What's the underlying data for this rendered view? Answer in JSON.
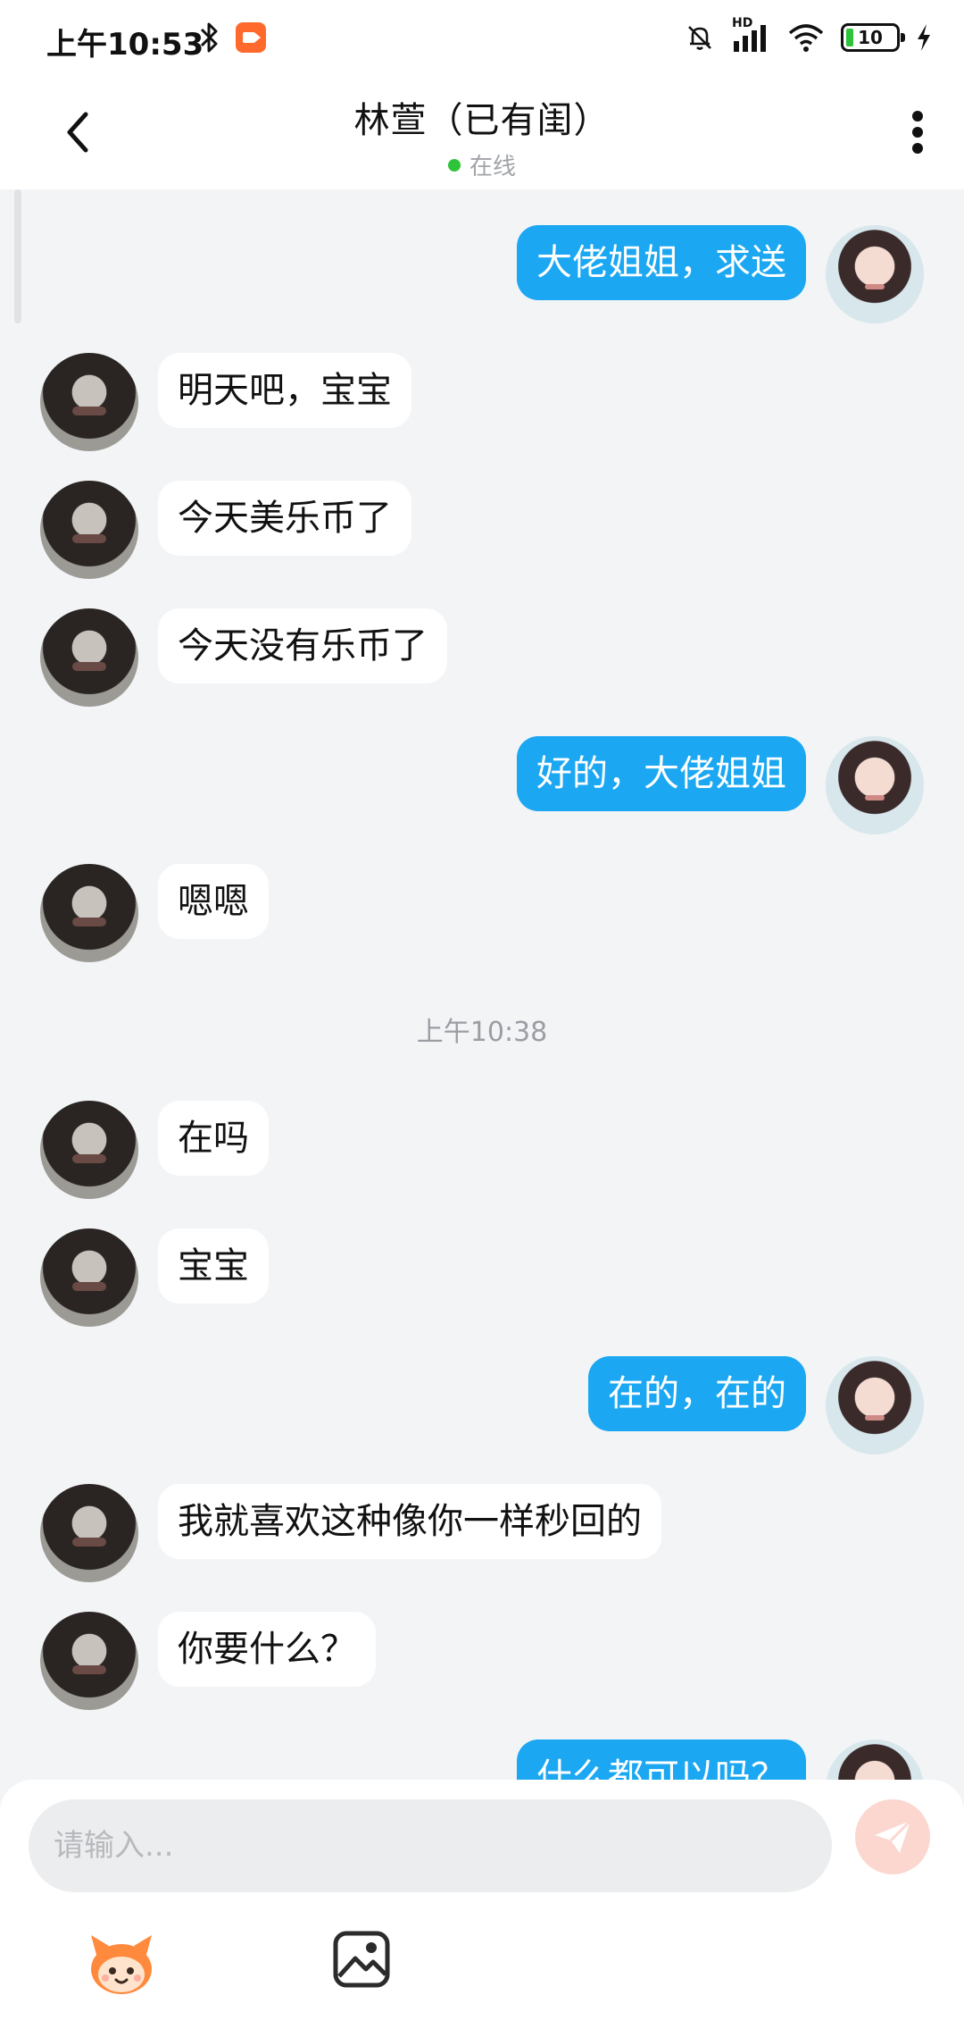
{
  "status_bar": {
    "time": "上午10:53",
    "battery_level": "10",
    "hd_label": "HD"
  },
  "header": {
    "title": "林萱（已有闺）",
    "status": "在线"
  },
  "messages": [
    {
      "side": "right",
      "text": "大佬姐姐，求送"
    },
    {
      "side": "left",
      "text": "明天吧，宝宝"
    },
    {
      "side": "left",
      "text": "今天美乐币了"
    },
    {
      "side": "left",
      "text": "今天没有乐币了"
    },
    {
      "side": "right",
      "text": "好的，大佬姐姐"
    },
    {
      "side": "left",
      "text": "嗯嗯"
    },
    {
      "timestamp": "上午10:38"
    },
    {
      "side": "left",
      "text": "在吗"
    },
    {
      "side": "left",
      "text": "宝宝"
    },
    {
      "side": "right",
      "text": "在的，在的"
    },
    {
      "side": "left",
      "text": "我就喜欢这种像你一样秒回的"
    },
    {
      "side": "left",
      "text": "你要什么？"
    },
    {
      "side": "right",
      "text": "什么都可以吗？"
    }
  ],
  "composer": {
    "placeholder": "请输入..."
  },
  "colors": {
    "accent_bubble": "#1ba7f2",
    "online_dot": "#2ec43a",
    "send_button": "#fbd7cf",
    "background": "#f2f4f6"
  },
  "icons": {
    "back": "chevron-left-icon",
    "more": "more-vertical-icon",
    "send": "paper-plane-icon",
    "emoji": "mascot-emoji-icon",
    "image": "image-icon"
  }
}
